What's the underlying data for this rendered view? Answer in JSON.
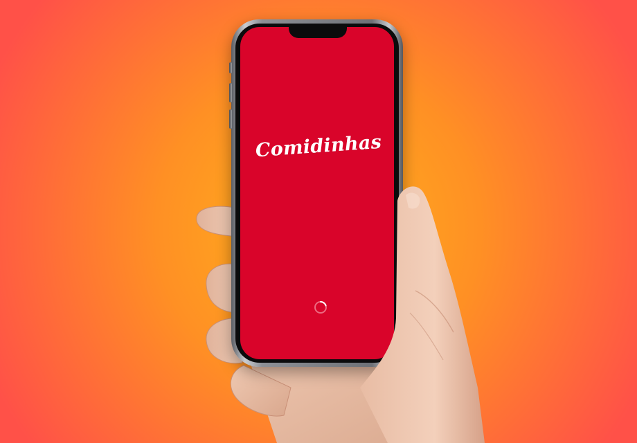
{
  "app": {
    "name": "Comidinhas",
    "screen": "splash",
    "loading": true
  },
  "colors": {
    "background_center": "#ffb21c",
    "background_edge": "#ff5148",
    "screen_background": "#d9042a",
    "logo_text": "#ffffff",
    "spinner_track": "#ec6a80",
    "spinner_arc": "#ffffff"
  },
  "icons": {
    "loading": "loading-spinner-icon"
  }
}
